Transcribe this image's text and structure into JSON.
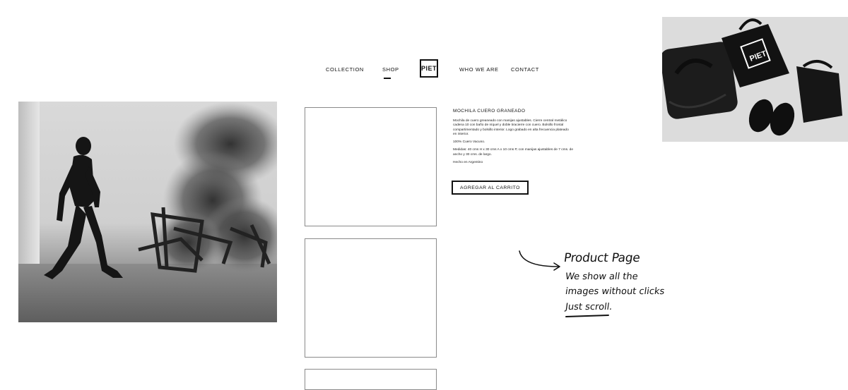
{
  "nav": {
    "collection": "COLLECTION",
    "shop": "SHOP",
    "logo": "PIET",
    "who_we_are": "WHO WE ARE",
    "contact": "CONTACT"
  },
  "product": {
    "title": "MOCHILA CUERO GRANEADO",
    "description": "Mochila de cuero greaneado con manijas ajustables. Cierre central metálico cadena 10 con baño de níquel y doble tiracierre con cuero. Bolsillo frontal compartimentado y bolsillo interior. Logo grabado en alta frecuencia plateado en interior.",
    "material": "100% Cuero Vacuno.",
    "measures": "Medidas: 40 cms H x 30 cms A x 10 cms P, con manijas ajustables de 7 cms. de ancho y 30 cms. de largo.",
    "origin": "Hecho en Argentino",
    "cart_button": "AGREGAR AL CARRITO"
  },
  "annotation": {
    "line1": "Product Page",
    "line2": "We show all the",
    "line3": "images without clicks",
    "line4": "Just scroll."
  },
  "photos": {
    "right_bag_logo": "PIET"
  },
  "colors": {
    "text": "#111111",
    "border": "#8a8a8a",
    "background": "#ffffff"
  }
}
